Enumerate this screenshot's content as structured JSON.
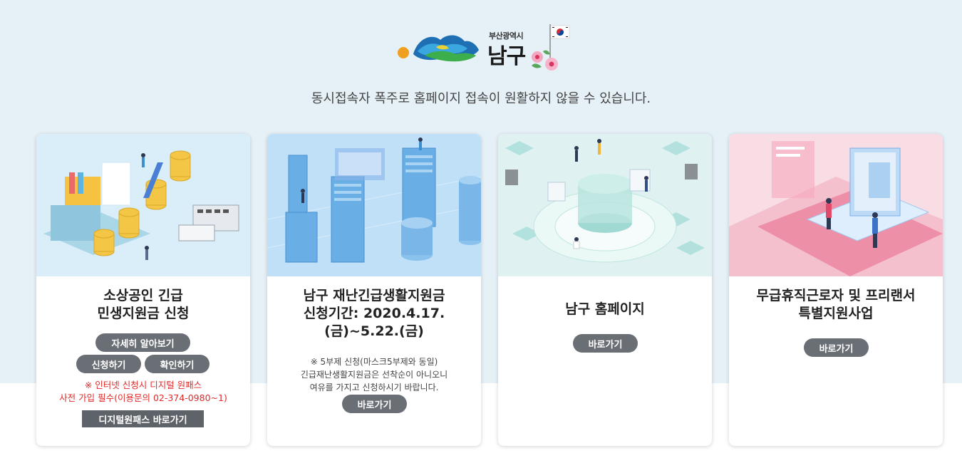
{
  "header": {
    "logo_small": "부산광역시",
    "logo_big": "남구",
    "notice": "동시접속자 폭주로 홈페이지 접속이 원활하지 않을 수 있습니다."
  },
  "cards": [
    {
      "title_line1": "소상공인 긴급",
      "title_line2": "민생지원금 신청",
      "learn_more": "자세히 알아보기",
      "apply": "신청하기",
      "check": "확인하기",
      "note_line1": "※ 인터넷 신청시 디지털 원패스",
      "note_line2": "사전 가입 필수(이용문의 02-374-0980~1)",
      "digital_onepass": "디지털원패스 바로가기"
    },
    {
      "title_line1": "남구 재난긴급생활지원금",
      "title_line2": "신청기간: 2020.4.17.",
      "title_line3": "(금)~5.22.(금)",
      "note_line1": "※ 5부제 신청(마스크5부제와 동일)",
      "note_line2": "긴급재난생활지원금은 선착순이 아니오니",
      "note_line3": "여유를 가지고 신청하시기 바랍니다.",
      "go": "바로가기"
    },
    {
      "title_line1": "남구 홈페이지",
      "go": "바로가기"
    },
    {
      "title_line1": "무급휴직근로자 및 프리랜서",
      "title_line2": "특별지원사업",
      "go": "바로가기"
    }
  ],
  "colors": {
    "top_band": "#e6f1f7",
    "button": "#6a6e75",
    "note_red": "#e02a2a"
  }
}
